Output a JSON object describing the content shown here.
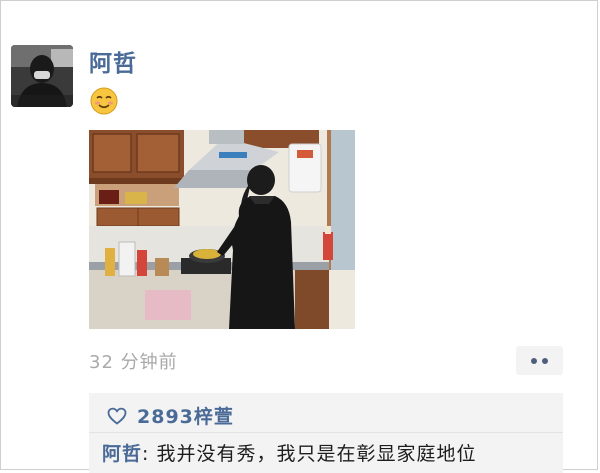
{
  "post": {
    "nickname": "阿哲",
    "emoji_icon": "slightly-smiling-blushing-emoji",
    "timestamp": "32 分钟前",
    "more_icon": "two-dots-icon"
  },
  "interactions": {
    "like_icon": "heart-outline-icon",
    "likes_text": "2893梓萱",
    "comments": [
      {
        "author": "阿哲",
        "separator": ": ",
        "text": "我并没有秀，我只是在彰显家庭地位"
      }
    ]
  },
  "colors": {
    "link_blue": "#4a6a98",
    "timestamp_gray": "#a9a9a9",
    "comment_bg": "#f3f3f3"
  }
}
